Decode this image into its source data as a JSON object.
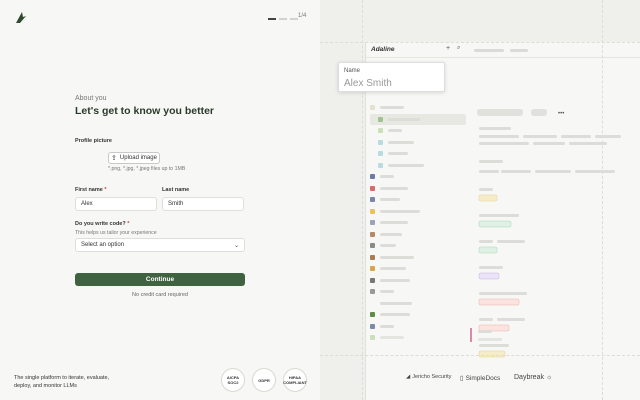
{
  "header": {
    "step": "1/4"
  },
  "form": {
    "eyebrow": "About you",
    "headline": "Let's get to know you better",
    "profile_label": "Profile picture",
    "upload_label": "Upload image",
    "upload_hint": "*.png, *.jpg, *.jpeg files up to 1MB",
    "first_name_label": "First name",
    "first_name_value": "Alex",
    "last_name_label": "Last name",
    "last_name_value": "Smith",
    "code_label": "Do you write code?",
    "code_hint": "This helps us tailor your experience",
    "code_select": "Select an option",
    "required_mark": "*",
    "continue_label": "Continue",
    "no_cc": "No credit card required"
  },
  "footer": {
    "tagline": "The single platform to iterate, evaluate, deploy, and monitor LLMs",
    "badges": [
      "AICPA SOC2",
      "GDPR",
      "HIPAA COMPLIANT"
    ]
  },
  "preview": {
    "app_name": "Adaline",
    "name_card": {
      "label": "Name",
      "value": "Alex Smith"
    },
    "partners": [
      "Jericho Security",
      "SimpleDocs",
      "Daybreak"
    ]
  },
  "colors": {
    "accent": "#3f6240",
    "required": "#c94040"
  }
}
